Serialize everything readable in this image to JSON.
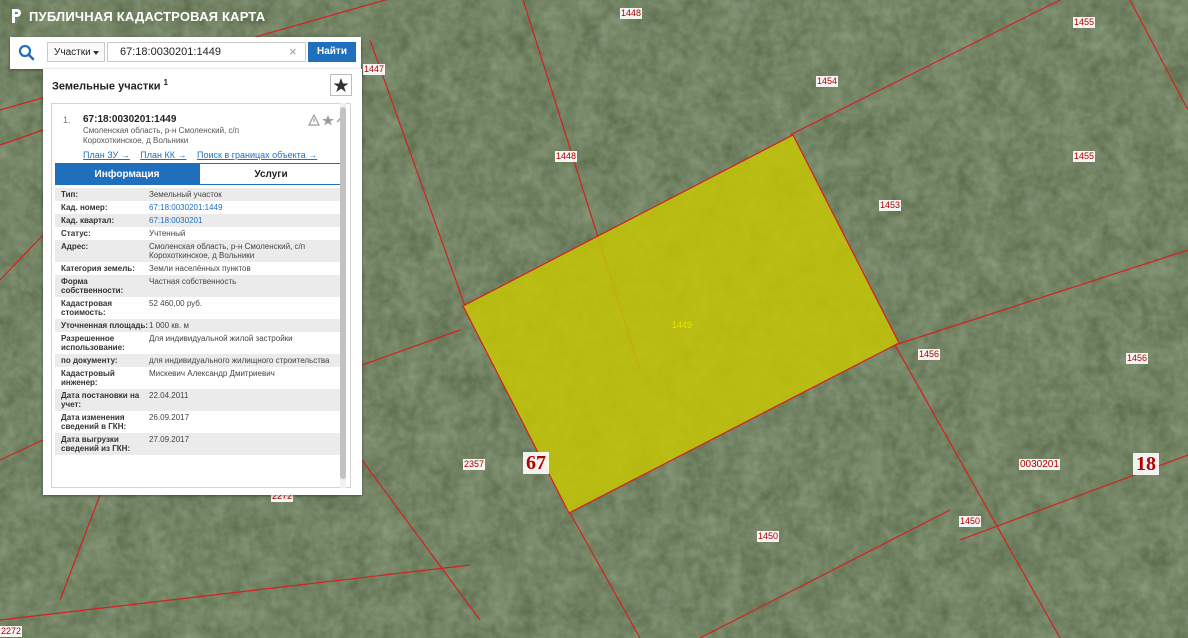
{
  "app": {
    "title": "ПУБЛИЧНАЯ КАДАСТРОВАЯ КАРТА"
  },
  "search": {
    "type_selected": "Участки",
    "query": "67:18:0030201:1449",
    "clear_glyph": "×",
    "find_label": "Найти"
  },
  "panel": {
    "title": "Земельные участки",
    "count_sup": "1",
    "result": {
      "index": "1.",
      "cadastral_number": "67:18:0030201:1449",
      "address": "Смоленская область, р-н Смоленский, с/п Корохоткинское, д Вольники",
      "links": [
        "План ЗУ →",
        "План КК →",
        "Поиск в границах объекта →"
      ]
    },
    "tabs": [
      {
        "label": "Информация",
        "active": true
      },
      {
        "label": "Услуги",
        "active": false
      }
    ],
    "info": [
      {
        "label": "Тип:",
        "value": "Земельный участок"
      },
      {
        "label": "Кад. номер:",
        "value": "67:18:0030201:1449",
        "link": true
      },
      {
        "label": "Кад. квартал:",
        "value": "67:18:0030201",
        "link": true
      },
      {
        "label": "Статус:",
        "value": "Учтенный"
      },
      {
        "label": "Адрес:",
        "value": "Смоленская область, р-н Смоленский, с/п Корохоткинское, д Вольники"
      },
      {
        "label": "Категория земель:",
        "value": "Земли населённых пунктов"
      },
      {
        "label": "Форма собственности:",
        "value": "Частная собственность"
      },
      {
        "label": "Кадастровая стоимость:",
        "value": "52 460,00 руб."
      },
      {
        "label": "Уточненная площадь:",
        "value": "1 000 кв. м"
      },
      {
        "label": "Разрешенное использование:",
        "value": "Для индивидуальной жилой застройки"
      },
      {
        "label": "по документу:",
        "value": "для индивидуального жилищного строительства"
      },
      {
        "label": "Кадастровый инженер:",
        "value": "Мискевич Александр Дмитриевич"
      },
      {
        "label": "Дата постановки на учет:",
        "value": "22.04.2011"
      },
      {
        "label": "Дата изменения сведений в ГКН:",
        "value": "26.09.2017"
      },
      {
        "label": "Дата выгрузки сведений из ГКН:",
        "value": "27.09.2017"
      }
    ]
  },
  "map": {
    "parcel_labels": [
      "1448",
      "1455",
      "1447",
      "1454",
      "1448",
      "1455",
      "1453",
      "1456",
      "1456",
      "2357",
      "1450",
      "1450",
      "0030201",
      "2272",
      "2272"
    ],
    "selected_label": "1449",
    "district_label": "67",
    "region_label": "18",
    "selected_color": "#c8c800",
    "boundary_color": "#d42020"
  }
}
